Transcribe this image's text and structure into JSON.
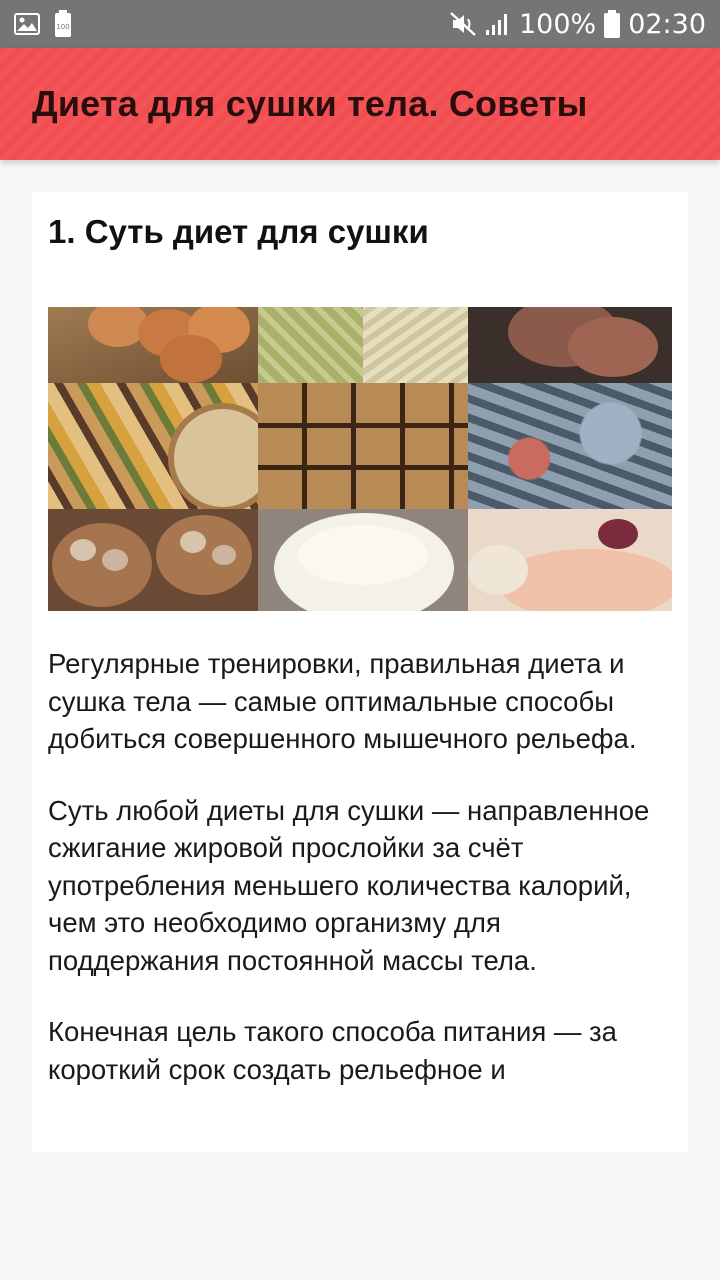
{
  "status_bar": {
    "battery_percent": "100%",
    "time": "02:30",
    "icons": [
      "image-icon",
      "battery-saver-icon",
      "mute-icon",
      "signal-icon",
      "battery-icon"
    ]
  },
  "app_bar": {
    "title": "Диета для сушки тела. Советы",
    "color": "#f24d50"
  },
  "article": {
    "section_title": "1. Суть диет для сушки",
    "image_alt": "food-collage",
    "paragraphs": [
      "Регулярные тренировки, правильная диета и сушка тела — самые оптимальные способы добиться совершенного мышечного рельефа.",
      "Суть любой диеты для сушки — направленное сжигание жировой прослойки за счёт употребления меньшего количества калорий, чем это необходимо организму для поддержания постоянной массы тела.",
      "Конечная цель такого способа питания — за короткий срок создать рельефное и"
    ]
  }
}
